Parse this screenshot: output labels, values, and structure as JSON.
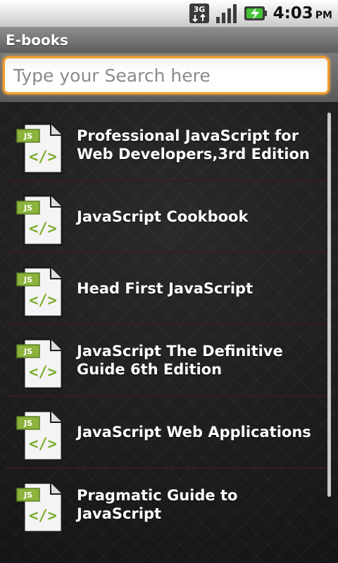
{
  "status_bar": {
    "network_label": "3G",
    "time": "4:03",
    "ampm": "PM"
  },
  "app": {
    "title": "E-books"
  },
  "search": {
    "placeholder": "Type your Search here",
    "value": "",
    "accent_color": "#f39c2b"
  },
  "icons": {
    "file_badge": "JS",
    "file_glyph": "</>"
  },
  "books": [
    {
      "title": "Professional JavaScript for Web Developers,3rd Edition"
    },
    {
      "title": "JavaScript Cookbook"
    },
    {
      "title": "Head First JavaScript"
    },
    {
      "title": "JavaScript The Definitive Guide 6th Edition"
    },
    {
      "title": "JavaScript Web Applications"
    },
    {
      "title": "Pragmatic Guide to JavaScript"
    }
  ]
}
